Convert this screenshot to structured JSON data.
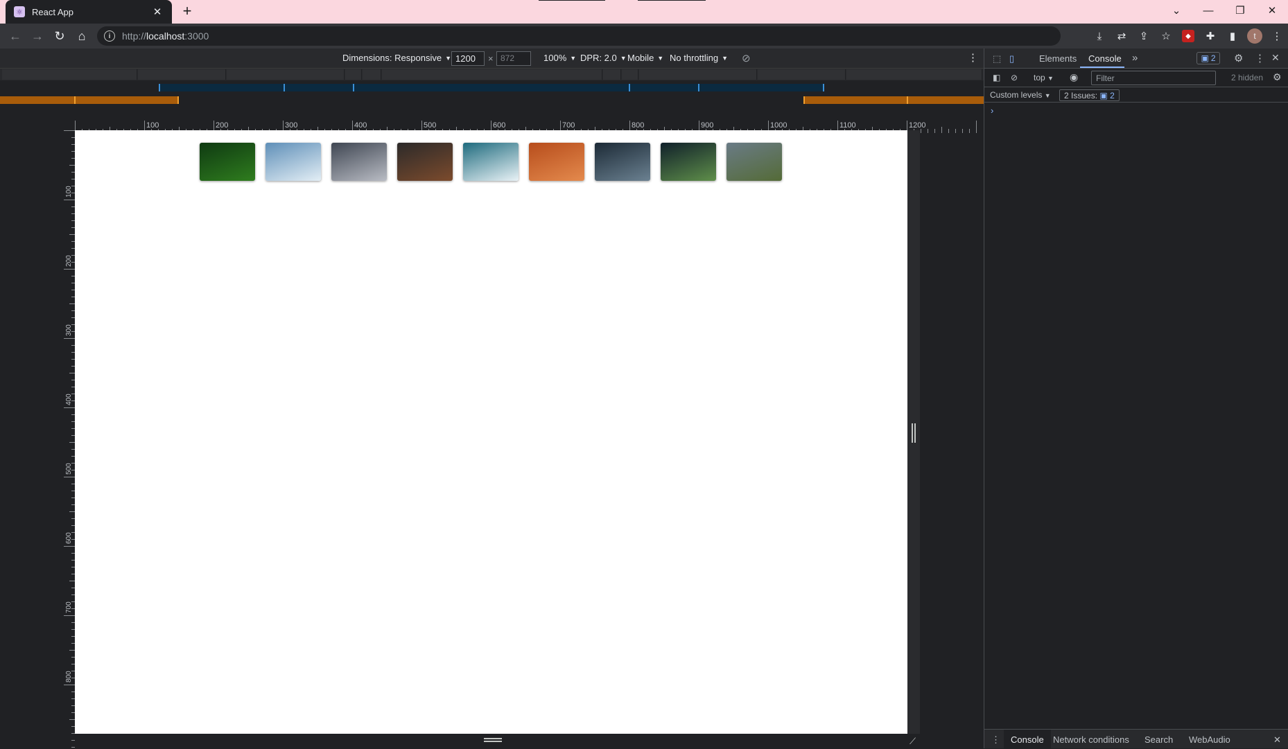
{
  "browser": {
    "tab_title": "React App",
    "tab_close": "✕",
    "new_tab": "+",
    "url_protocol": "http://",
    "url_host": "localhost",
    "url_port": ":3000",
    "avatar_letter": "t"
  },
  "device_toolbar": {
    "dimensions_label": "Dimensions: Responsive",
    "width_value": "1200",
    "times": "×",
    "height_value": "872",
    "zoom": "100%",
    "dpr": "DPR: 2.0",
    "device_type": "Mobile",
    "throttling": "No throttling"
  },
  "rulers": {
    "horizontal": [
      "100",
      "200",
      "300",
      "400",
      "500",
      "600",
      "700",
      "800",
      "900",
      "1000",
      "1100",
      "1200"
    ],
    "vertical": [
      "100",
      "200",
      "300",
      "400",
      "500",
      "600",
      "700",
      "800"
    ]
  },
  "thumbnails": [
    {
      "name": "forest",
      "colors": [
        "#0f3a12",
        "#2f7d1e"
      ]
    },
    {
      "name": "aurora-mountains",
      "colors": [
        "#5f8fb8",
        "#e3eef5"
      ]
    },
    {
      "name": "snowy-peaks",
      "colors": [
        "#3f4652",
        "#b9bcc4"
      ]
    },
    {
      "name": "desert-butte",
      "colors": [
        "#2c2a2a",
        "#7c4b2c"
      ]
    },
    {
      "name": "aurora-snow",
      "colors": [
        "#1f6b7e",
        "#e9f2f6"
      ]
    },
    {
      "name": "sand-dunes",
      "colors": [
        "#b74d1c",
        "#e48a4d"
      ]
    },
    {
      "name": "milky-way",
      "colors": [
        "#1c2a36",
        "#6b8191"
      ]
    },
    {
      "name": "aurora-lake",
      "colors": [
        "#10202a",
        "#5f8f4a"
      ]
    },
    {
      "name": "green-valley",
      "colors": [
        "#6a7b86",
        "#546b37"
      ]
    }
  ],
  "devtools": {
    "tabs": [
      "Elements",
      "Console"
    ],
    "active_tab": "Console",
    "more": "»",
    "badge_count": "2",
    "context": "top",
    "filter_placeholder": "Filter",
    "hidden": "2 hidden",
    "levels": "Custom levels",
    "issues_label": "2 Issues:",
    "issues_count": "2",
    "prompt": "›",
    "drawer_tabs": [
      "Console",
      "Network conditions",
      "Search",
      "WebAudio"
    ]
  }
}
